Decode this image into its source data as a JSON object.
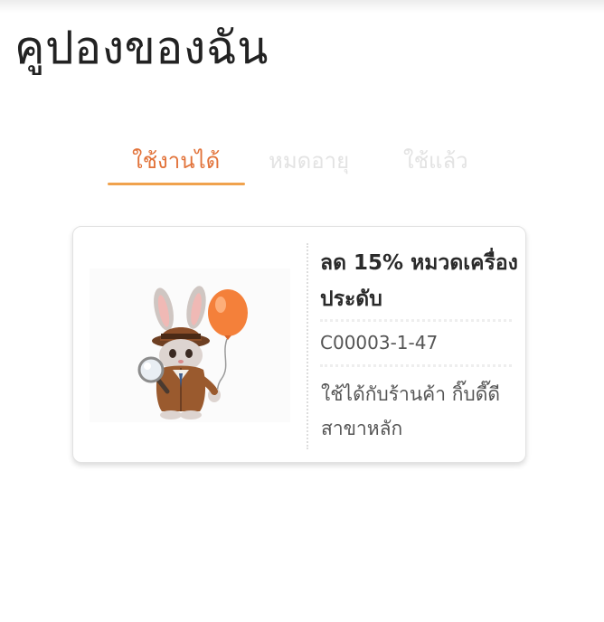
{
  "page": {
    "title": "คูปองของฉัน"
  },
  "tabs": [
    {
      "label": "ใช้งานได้",
      "active": true
    },
    {
      "label": "หมดอายุ",
      "active": false
    },
    {
      "label": "ใช้แล้ว",
      "active": false
    }
  ],
  "colors": {
    "accent": "#e2733a",
    "underline": "#f0a24d",
    "inactive_tab": "#e3e3e3",
    "balloon": "#f4803a"
  },
  "coupons": [
    {
      "title": "ลด 15% หมวดเครื่องประดับ",
      "code": "C00003-1-47",
      "store": " ใช้ได้กับร้านค้า กิ๊บดี๊ดี สาขาหลัก",
      "image_icon": "detective-bunny-balloon-illustration"
    }
  ]
}
